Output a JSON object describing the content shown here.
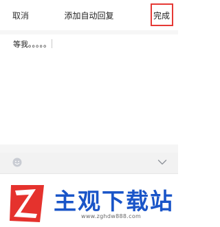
{
  "nav": {
    "cancel_label": "取消",
    "title": "添加自动回复",
    "done_label": "完成"
  },
  "editor": {
    "text": "等我。。。。。"
  },
  "toolbar": {
    "emoji_icon": "emoji-icon",
    "collapse_icon": "chevron-down-icon"
  },
  "watermark": {
    "logo_letter": "Z",
    "title": "主观下载站",
    "url": "www.zghdw888.com"
  },
  "colors": {
    "highlight": "#e53935",
    "brand_blue": "#1a55c8",
    "logo_red": "#e5322d"
  }
}
